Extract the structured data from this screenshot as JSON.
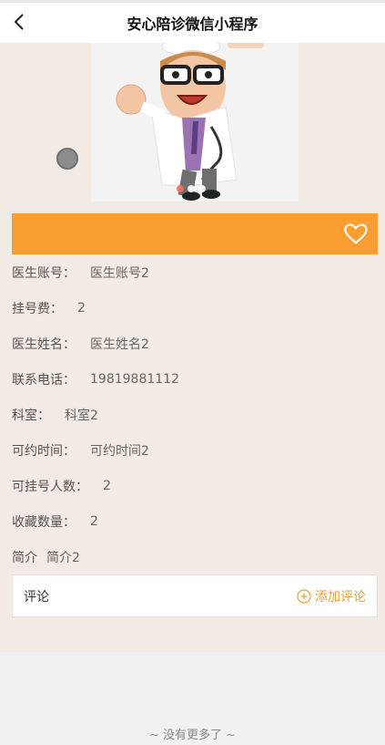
{
  "nav": {
    "title": "安心陪诊微信小程序"
  },
  "carousel": {
    "slide_count": 3,
    "active_index": 0
  },
  "fields": [
    {
      "label": "医生账号：",
      "value": "医生账号2"
    },
    {
      "label": "挂号费：",
      "value": "2"
    },
    {
      "label": "医生姓名：",
      "value": "医生姓名2"
    },
    {
      "label": "联系电话：",
      "value": "19819881112"
    },
    {
      "label": "科室：",
      "value": "科室2"
    },
    {
      "label": "可约时间：",
      "value": "可约时间2"
    },
    {
      "label": "可挂号人数：",
      "value": "2"
    },
    {
      "label": "收藏数量：",
      "value": "2"
    },
    {
      "label": "简介",
      "value": "简介2"
    }
  ],
  "comments": {
    "title": "评论",
    "add_label": "添加评论"
  },
  "footer": {
    "text": "~ 没有更多了 ~"
  },
  "colors": {
    "accent": "#fa9e31",
    "background": "#f2ebe5",
    "link": "#e8a03c"
  }
}
